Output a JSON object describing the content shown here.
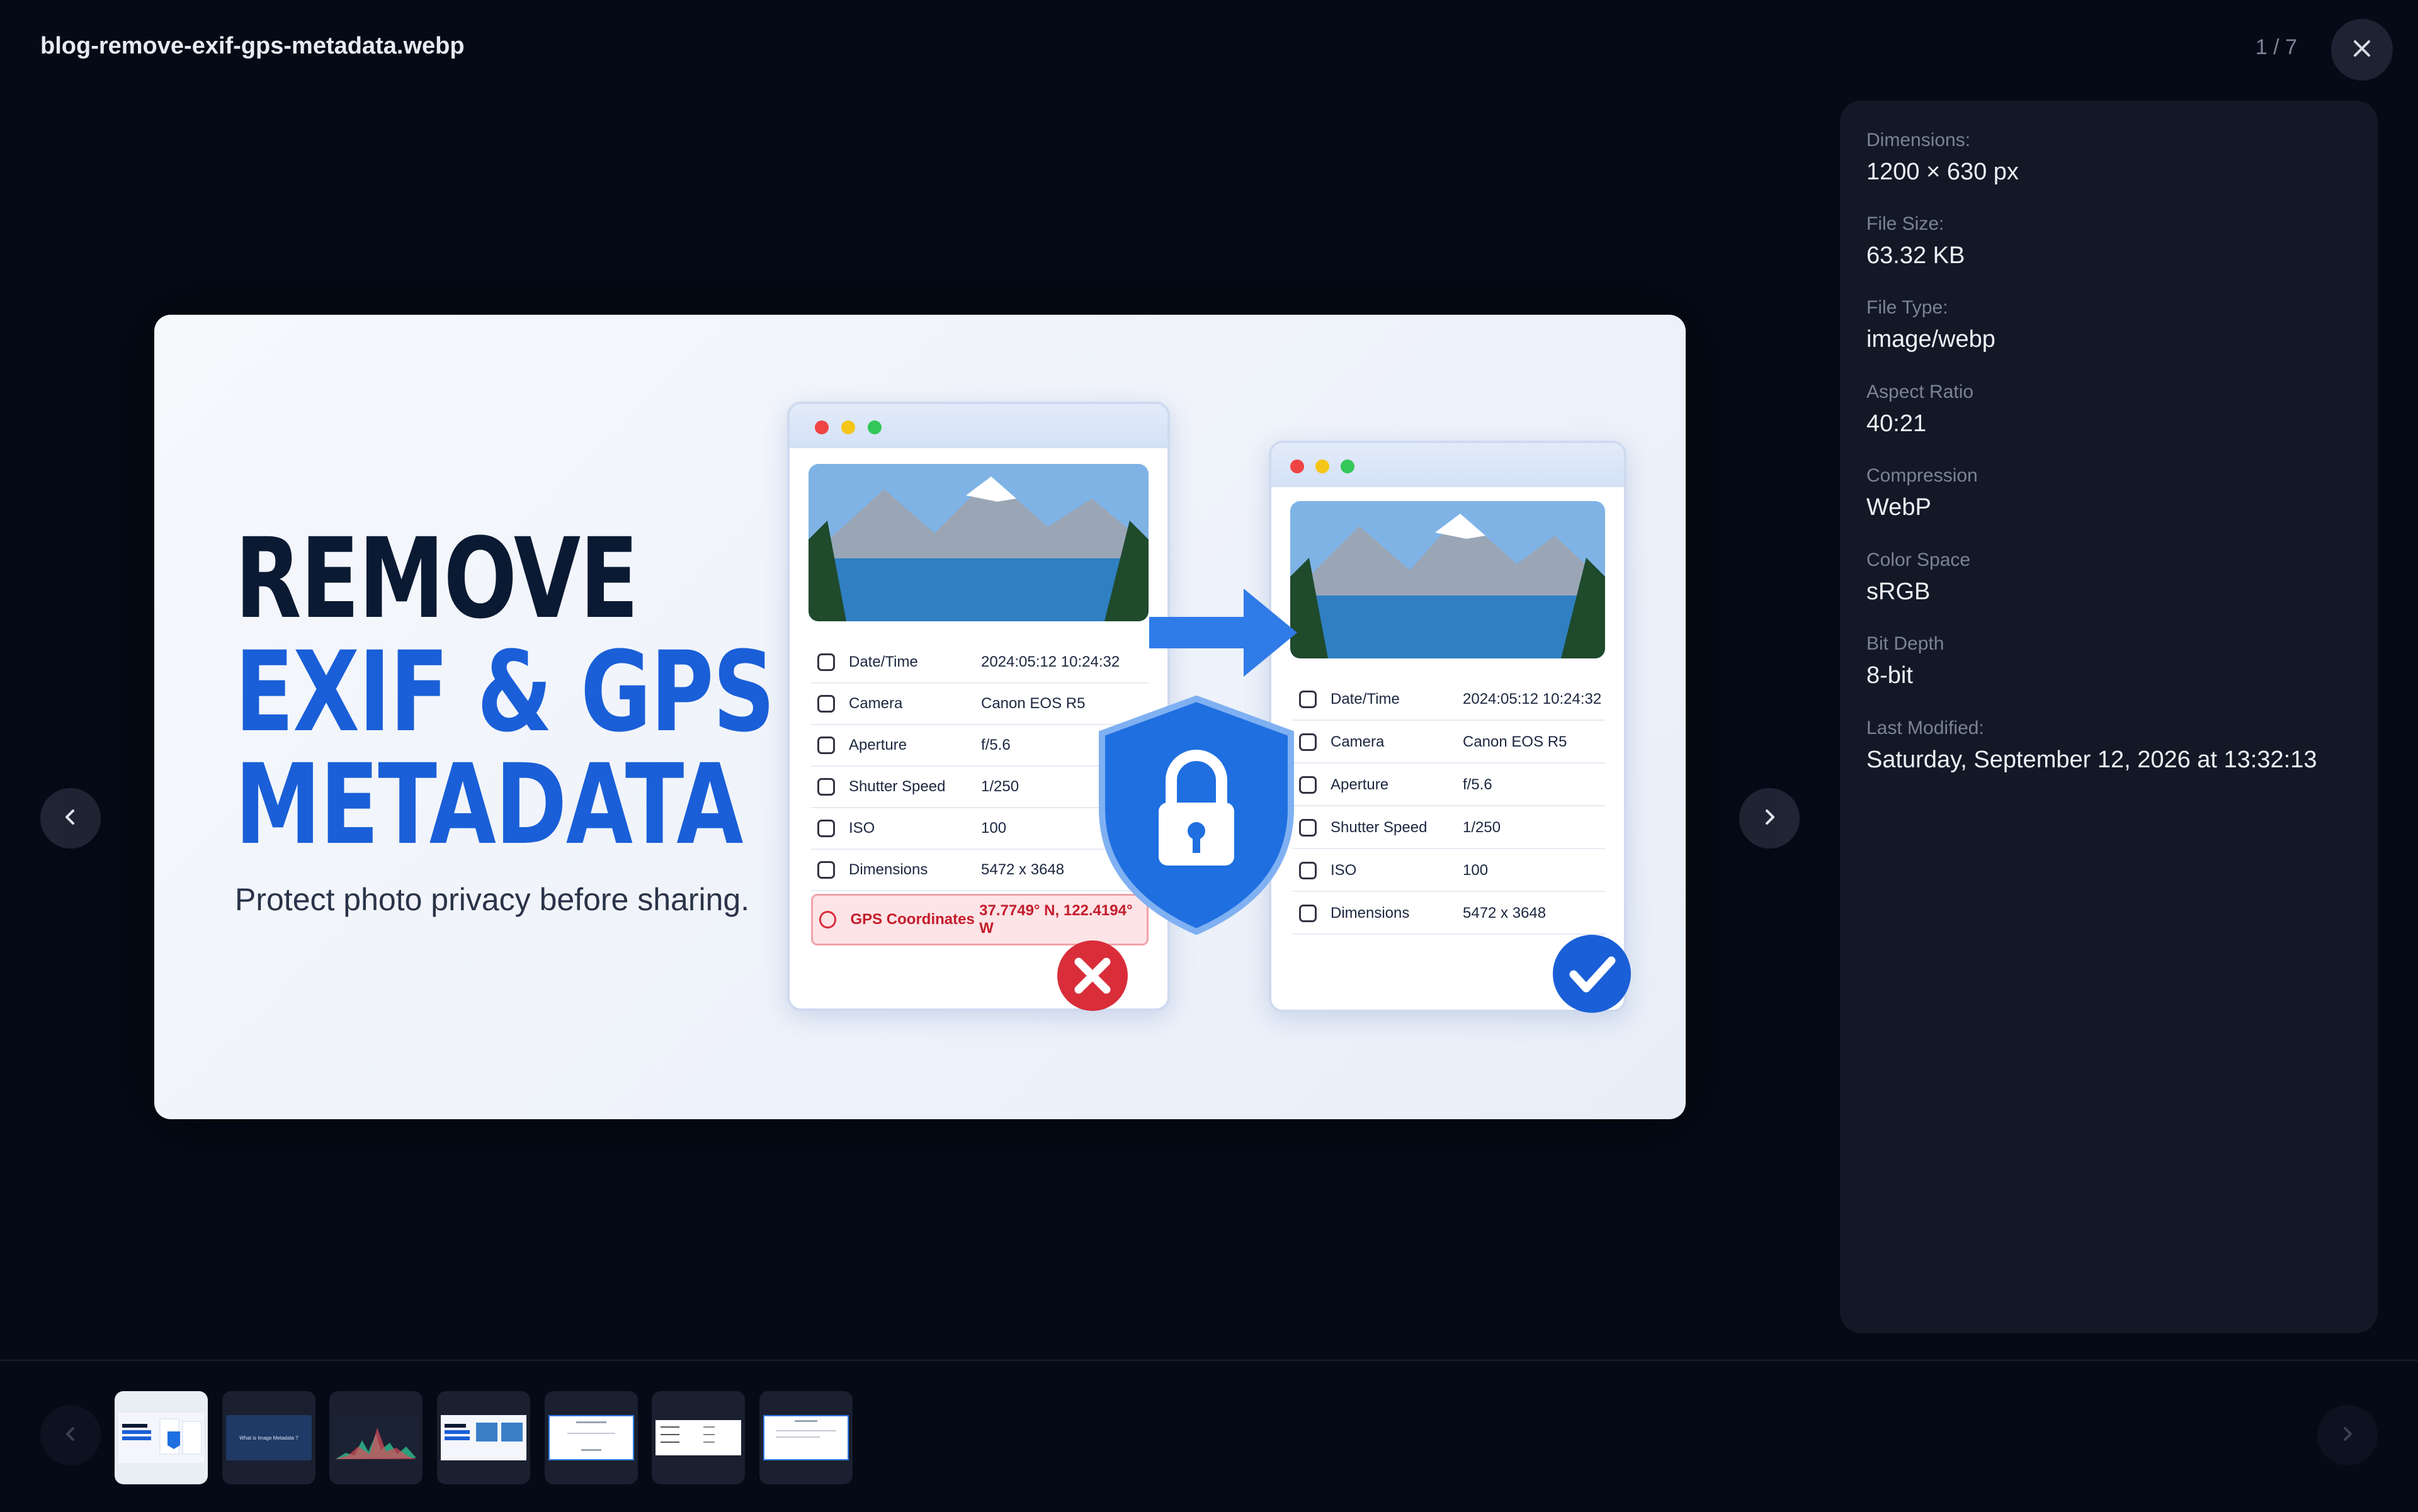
{
  "header": {
    "filename": "blog-remove-exif-gps-metadata.webp",
    "counter": "1 / 7",
    "close_icon": "close-icon"
  },
  "viewer": {
    "prev_icon": "chevron-left-icon",
    "next_icon": "chevron-right-icon",
    "preview": {
      "title_line1": "REMOVE",
      "title_line2": "EXIF & GPS",
      "title_line3": "METADATA",
      "subtitle": "Protect photo privacy before sharing.",
      "left_card": {
        "rows": [
          {
            "key": "Date/Time",
            "value": "2024:05:12 10:24:32"
          },
          {
            "key": "Camera",
            "value": "Canon EOS R5"
          },
          {
            "key": "Aperture",
            "value": "f/5.6"
          },
          {
            "key": "Shutter Speed",
            "value": "1/250"
          },
          {
            "key": "ISO",
            "value": "100"
          },
          {
            "key": "Dimensions",
            "value": "5472 x 3648"
          },
          {
            "key": "GPS Coordinates",
            "value": "37.7749° N, 122.4194° W"
          }
        ]
      },
      "right_card": {
        "rows": [
          {
            "key": "Date/Time",
            "value": "2024:05:12 10:24:32"
          },
          {
            "key": "Camera",
            "value": "Canon EOS R5"
          },
          {
            "key": "Aperture",
            "value": "f/5.6"
          },
          {
            "key": "Shutter Speed",
            "value": "1/250"
          },
          {
            "key": "ISO",
            "value": "100"
          },
          {
            "key": "Dimensions",
            "value": "5472 x 3648"
          }
        ]
      },
      "colors": {
        "accent_blue": "#1a5fd8",
        "dark_navy": "#0b1a33",
        "error_red": "#d92d3a"
      }
    }
  },
  "info": {
    "items": [
      {
        "label": "Dimensions:",
        "value": "1200 × 630 px"
      },
      {
        "label": "File Size:",
        "value": "63.32 KB"
      },
      {
        "label": "File Type:",
        "value": "image/webp"
      },
      {
        "label": "Aspect Ratio",
        "value": "40:21"
      },
      {
        "label": "Compression",
        "value": "WebP"
      },
      {
        "label": "Color Space",
        "value": "sRGB"
      },
      {
        "label": "Bit Depth",
        "value": "8-bit"
      },
      {
        "label": "Last Modified:",
        "value": "Saturday, September 12, 2026 at 13:32:13"
      }
    ]
  },
  "thumbnails": {
    "prev_icon": "chevron-left-icon",
    "next_icon": "chevron-right-icon",
    "items": [
      {
        "active": true
      },
      {
        "caption": "What is Image Metadata ?"
      },
      {},
      {},
      {},
      {},
      {}
    ]
  }
}
